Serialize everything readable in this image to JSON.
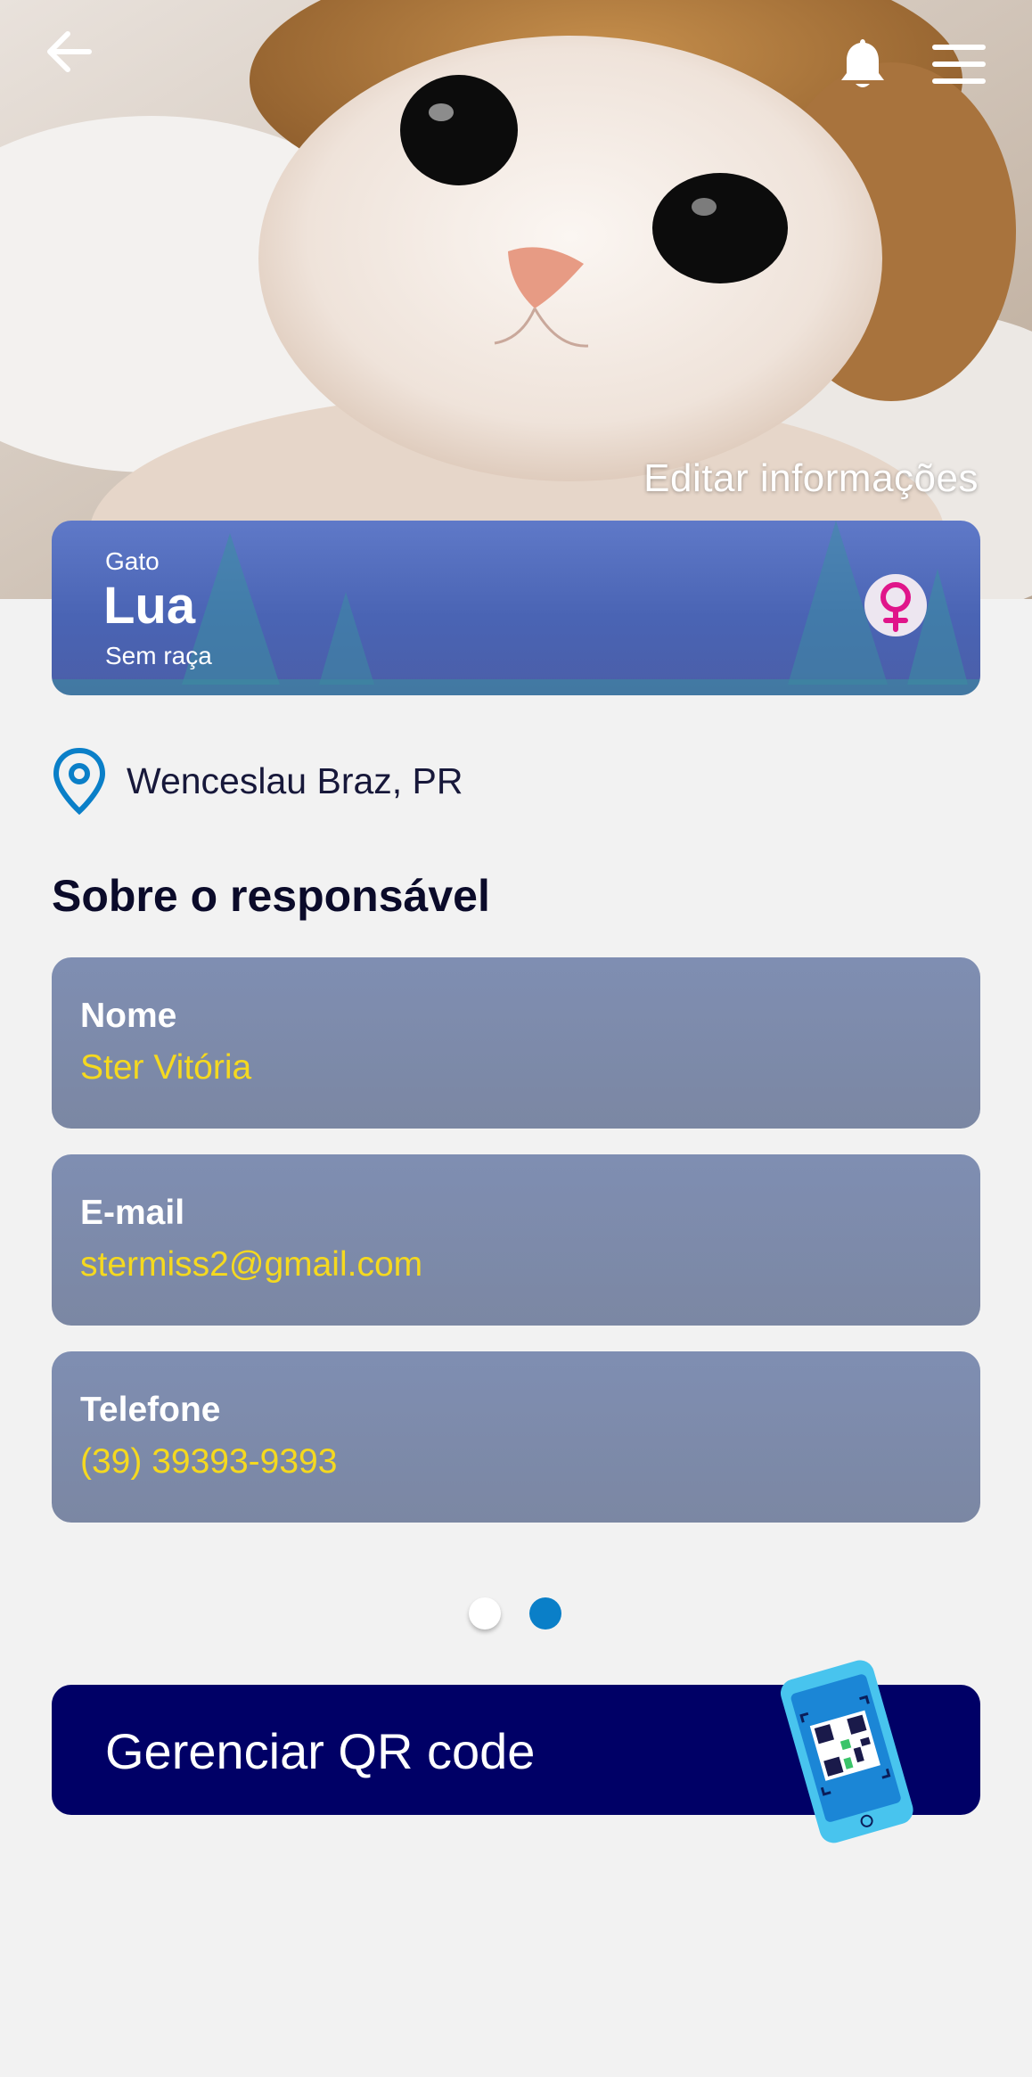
{
  "header": {
    "back_icon": "arrow-left-icon",
    "notifications_icon": "bell-icon",
    "menu_icon": "hamburger-menu-icon",
    "edit_label": "Editar informações"
  },
  "pet": {
    "species": "Gato",
    "name": "Lua",
    "breed": "Sem raça",
    "gender_icon": "female-symbol-icon",
    "gender_color": "#e0158a"
  },
  "location": {
    "icon": "map-pin-icon",
    "text": "Wenceslau Braz, PR"
  },
  "owner_section": {
    "title": "Sobre o responsável",
    "fields": [
      {
        "label": "Nome",
        "value": "Ster Vitória"
      },
      {
        "label": "E-mail",
        "value": "stermiss2@gmail.com"
      },
      {
        "label": "Telefone",
        "value": "(39) 39393-9393"
      }
    ]
  },
  "pagination": {
    "current_page": 2,
    "total_pages": 2
  },
  "qr_button": {
    "label": "Gerenciar QR code",
    "icon": "phone-qr-code-icon"
  },
  "colors": {
    "accent_blue": "#0a7fc8",
    "dark_navy": "#000066",
    "value_yellow": "#f5d91f",
    "card_slate": "#7f8eb2"
  }
}
